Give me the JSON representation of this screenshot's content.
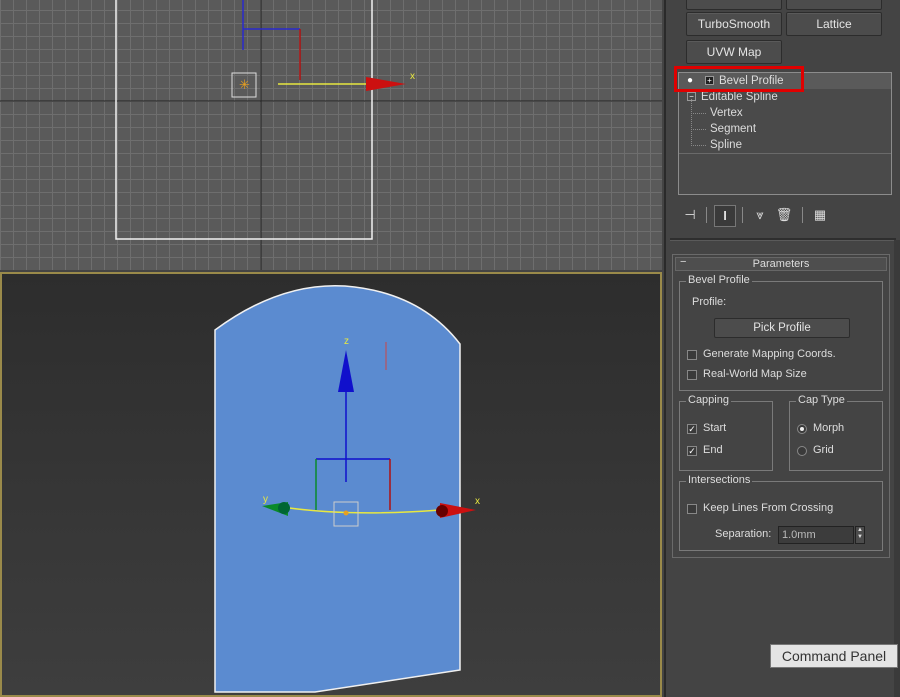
{
  "modifier_buttons": {
    "turbosmooth": "TurboSmooth",
    "lattice": "Lattice",
    "uvw_map": "UVW Map"
  },
  "stack": {
    "items": [
      {
        "label": "Bevel Profile"
      },
      {
        "label": "Editable Spline"
      },
      {
        "label": "Vertex"
      },
      {
        "label": "Segment"
      },
      {
        "label": "Spline"
      }
    ]
  },
  "rollout": {
    "title": "Parameters",
    "bevel_profile_group": "Bevel Profile",
    "profile_label": "Profile:",
    "pick_profile": "Pick Profile",
    "generate_mapping": "Generate Mapping Coords.",
    "real_world": "Real-World Map Size",
    "capping_group": "Capping",
    "cap_start": "Start",
    "cap_end": "End",
    "cap_type_group": "Cap Type",
    "morph": "Morph",
    "grid": "Grid",
    "intersections_group": "Intersections",
    "keep_lines": "Keep Lines From Crossing",
    "separation_label": "Separation:",
    "separation_value": "1.0mm"
  },
  "checks": {
    "generate_mapping": false,
    "real_world": false,
    "cap_start": true,
    "cap_end": true,
    "keep_lines": false
  },
  "cap_type_selected": "Morph",
  "viewport": {
    "axis_x": "x",
    "axis_y": "y",
    "axis_z": "z"
  },
  "tooltip": "Command Panel",
  "colors": {
    "highlight": "#e00000",
    "object": "#5b8bd0",
    "x_axis": "#cc1010",
    "y_axis": "#0a8a2a",
    "z_axis": "#1010cc",
    "gizmo_yellow": "#e8e840"
  }
}
